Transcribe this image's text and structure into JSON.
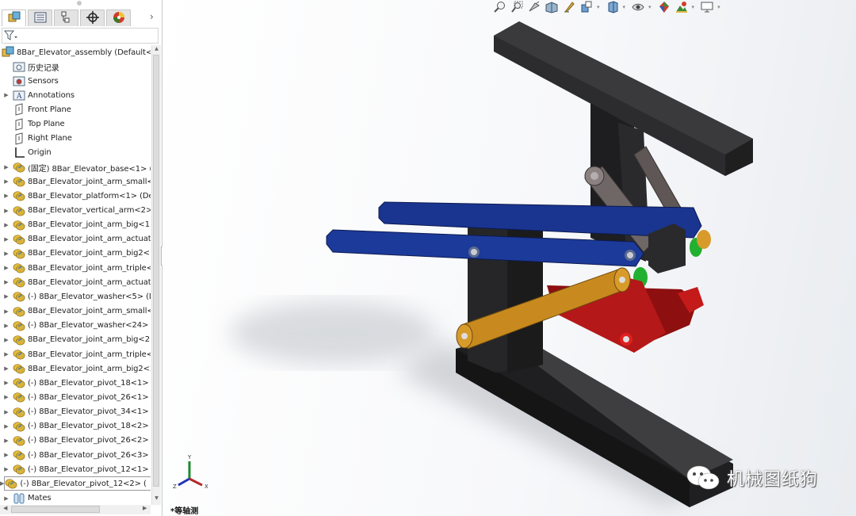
{
  "panel": {
    "tabs": [
      {
        "name": "featuremanager-tab",
        "icon": "assembly-icon",
        "active": true
      },
      {
        "name": "propertymanager-tab",
        "icon": "property-list-icon",
        "active": false
      },
      {
        "name": "configurationmanager-tab",
        "icon": "configuration-icon",
        "active": false
      },
      {
        "name": "dimxpert-tab",
        "icon": "crosshair-icon",
        "active": false
      },
      {
        "name": "displaymanager-tab",
        "icon": "appearance-ball-icon",
        "active": false
      }
    ],
    "more_glyph": "›",
    "filter_icon": "filter-icon",
    "root": {
      "label": "8Bar_Elevator_assembly  (Default<D",
      "icon": "assembly-icon"
    },
    "items": [
      {
        "label": "历史记录",
        "icon": "history-folder-icon",
        "expandable": false
      },
      {
        "label": "Sensors",
        "icon": "sensors-folder-icon",
        "expandable": false
      },
      {
        "label": "Annotations",
        "icon": "annotations-icon",
        "expandable": true
      },
      {
        "label": "Front Plane",
        "icon": "plane-icon",
        "expandable": false
      },
      {
        "label": "Top Plane",
        "icon": "plane-icon",
        "expandable": false
      },
      {
        "label": "Right Plane",
        "icon": "plane-icon",
        "expandable": false
      },
      {
        "label": "Origin",
        "icon": "origin-icon",
        "expandable": false
      },
      {
        "label": "(固定) 8Bar_Elevator_base<1> (",
        "icon": "part-icon",
        "expandable": true
      },
      {
        "label": "8Bar_Elevator_joint_arm_small<",
        "icon": "part-icon",
        "expandable": true
      },
      {
        "label": "8Bar_Elevator_platform<1> (De",
        "icon": "part-icon",
        "expandable": true
      },
      {
        "label": "8Bar_Elevator_vertical_arm<2>",
        "icon": "part-icon",
        "expandable": true
      },
      {
        "label": "8Bar_Elevator_joint_arm_big<1>",
        "icon": "part-icon",
        "expandable": true
      },
      {
        "label": "8Bar_Elevator_joint_arm_actuatc",
        "icon": "part-icon",
        "expandable": true
      },
      {
        "label": "8Bar_Elevator_joint_arm_big2<1",
        "icon": "part-icon",
        "expandable": true
      },
      {
        "label": "8Bar_Elevator_joint_arm_triple<",
        "icon": "part-icon",
        "expandable": true
      },
      {
        "label": "8Bar_Elevator_joint_arm_actuatc",
        "icon": "part-icon",
        "expandable": true
      },
      {
        "label": "(-) 8Bar_Elevator_washer<5> (D",
        "icon": "part-icon",
        "expandable": true
      },
      {
        "label": "8Bar_Elevator_joint_arm_small<",
        "icon": "part-icon",
        "expandable": true
      },
      {
        "label": "(-) 8Bar_Elevator_washer<24> (",
        "icon": "part-icon",
        "expandable": true
      },
      {
        "label": "8Bar_Elevator_joint_arm_big<2>",
        "icon": "part-icon",
        "expandable": true
      },
      {
        "label": "8Bar_Elevator_joint_arm_triple<",
        "icon": "part-icon",
        "expandable": true
      },
      {
        "label": "8Bar_Elevator_joint_arm_big2<2",
        "icon": "part-icon",
        "expandable": true
      },
      {
        "label": "(-) 8Bar_Elevator_pivot_18<1> (",
        "icon": "part-icon",
        "expandable": true
      },
      {
        "label": "(-) 8Bar_Elevator_pivot_26<1> (",
        "icon": "part-icon",
        "expandable": true
      },
      {
        "label": "(-) 8Bar_Elevator_pivot_34<1> (",
        "icon": "part-icon",
        "expandable": true
      },
      {
        "label": "(-) 8Bar_Elevator_pivot_18<2> (",
        "icon": "part-icon",
        "expandable": true
      },
      {
        "label": "(-) 8Bar_Elevator_pivot_26<2> (",
        "icon": "part-icon",
        "expandable": true
      },
      {
        "label": "(-) 8Bar_Elevator_pivot_26<3> (",
        "icon": "part-icon",
        "expandable": true
      },
      {
        "label": "(-) 8Bar_Elevator_pivot_12<1> (",
        "icon": "part-icon",
        "expandable": true
      },
      {
        "label": "(-) 8Bar_Elevator_pivot_12<2> (",
        "icon": "part-icon",
        "expandable": true,
        "selected": true
      },
      {
        "label": "Mates",
        "icon": "mates-icon",
        "expandable": true
      }
    ]
  },
  "viewport": {
    "heads_up_toolbar": [
      {
        "name": "zoom-to-fit-icon",
        "dropdown": false
      },
      {
        "name": "zoom-to-area-icon",
        "dropdown": false
      },
      {
        "name": "previous-view-icon",
        "dropdown": false
      },
      {
        "name": "section-view-icon",
        "dropdown": false
      },
      {
        "name": "dynamic-annotation-icon",
        "dropdown": false
      },
      {
        "name": "view-orientation-icon",
        "dropdown": true
      },
      {
        "name": "display-style-icon",
        "dropdown": true
      },
      {
        "name": "hide-show-items-icon",
        "dropdown": true
      },
      {
        "name": "edit-appearance-icon",
        "dropdown": false
      },
      {
        "name": "apply-scene-icon",
        "dropdown": true
      },
      {
        "name": "view-settings-icon",
        "dropdown": true
      }
    ],
    "triad_axes": {
      "x": "X",
      "y": "Y",
      "z": "Z"
    },
    "view_name": "*等轴测",
    "watermark": "机械图纸狗",
    "colors": {
      "frame": "#2e2e30",
      "blue_arm": "#1c3a9a",
      "orange_arm": "#c88a1e",
      "red_arm": "#b01515",
      "green_washer": "#22b030",
      "grey_link": "#6f6766"
    }
  }
}
